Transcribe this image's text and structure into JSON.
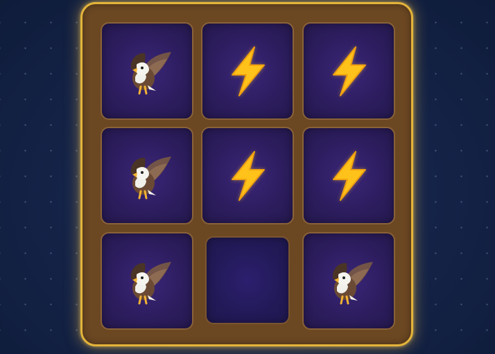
{
  "board": {
    "rows": 3,
    "cols": 3,
    "cells": [
      [
        "eagle",
        "lightning",
        "lightning"
      ],
      [
        "eagle",
        "lightning",
        "lightning"
      ],
      [
        "eagle",
        "empty",
        "eagle"
      ]
    ]
  },
  "colors": {
    "frame_border": "#e3b43a",
    "frame_fill": "#6b4722",
    "cell_fill": "#2d1d5f",
    "bolt": "#ffc21a"
  },
  "icons": {
    "eagle": "eagle-icon",
    "lightning": "lightning-icon"
  }
}
